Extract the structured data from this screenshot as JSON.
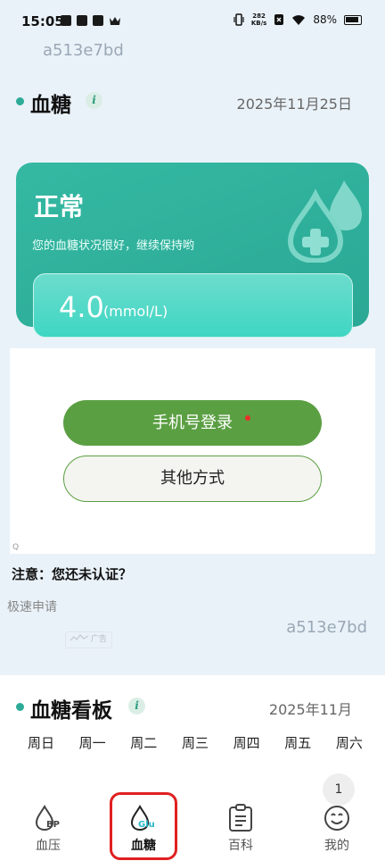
{
  "status_bar": {
    "time": "15:05",
    "net_speed_value": "282",
    "net_speed_unit": "KB/s",
    "battery": "88%"
  },
  "device_id": "a513e7bd",
  "glucose_section": {
    "title": "血糖",
    "info": "i",
    "date": "2025年11月25日"
  },
  "status_card": {
    "status": "正常",
    "description": "您的血糖状况很好，继续保持哟",
    "value": "4.0",
    "unit": "(mmol/L)"
  },
  "ad": {
    "login_button": "手机号登录",
    "other_button": "其他方式",
    "corner_mark": "Q",
    "notice": "注意：您还未认证？",
    "quick_apply": "极速申请",
    "badge": "广告"
  },
  "dashboard": {
    "title": "血糖看板",
    "info": "i",
    "month": "2025年11月",
    "weekdays": [
      "周日",
      "周一",
      "周二",
      "周三",
      "周四",
      "周五",
      "周六"
    ]
  },
  "float_badge": "1",
  "tabbar": {
    "tabs": [
      {
        "label": "血压",
        "icon": "blood-pressure-drop-icon",
        "icon_text": "BP"
      },
      {
        "label": "血糖",
        "icon": "glucose-drop-icon",
        "icon_text": "Glu",
        "active": true
      },
      {
        "label": "百科",
        "icon": "encyclopedia-clipboard-icon"
      },
      {
        "label": "我的",
        "icon": "smiley-face-icon"
      }
    ]
  },
  "colors": {
    "accent": "#2dab98",
    "login_green": "#5b9f43",
    "highlight_red": "#e02020"
  }
}
